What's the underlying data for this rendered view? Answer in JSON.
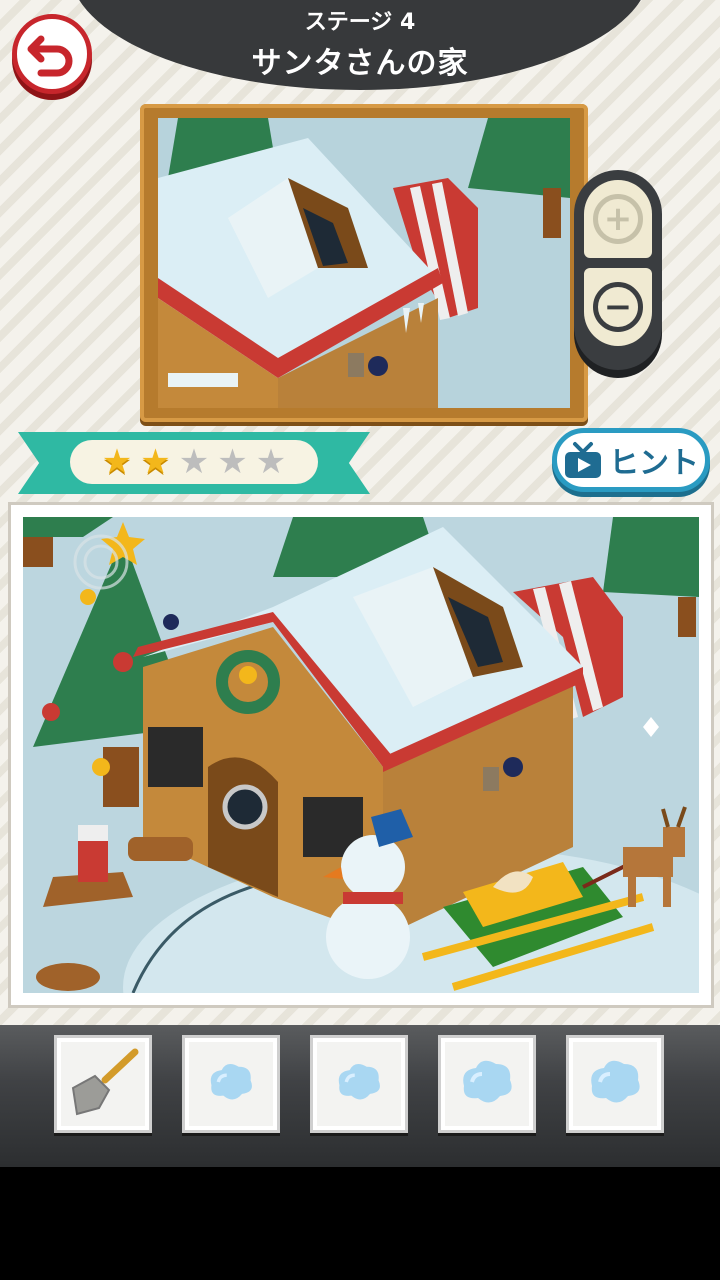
{
  "header": {
    "stage_label": "ステージ 4",
    "stage_title": "サンタさんの家"
  },
  "back_icon": "back-arrow-icon",
  "zoom": {
    "in_icon": "plus-icon",
    "out_icon": "minus-icon",
    "in_symbol": "+",
    "out_symbol": "−"
  },
  "stars": {
    "earned": 2,
    "total": 5
  },
  "hint": {
    "label": "ヒント",
    "icon": "tv-icon"
  },
  "inventory": [
    {
      "item": "shovel",
      "icon": "shovel-icon"
    },
    {
      "item": "snow-clump",
      "icon": "snow-clump-icon"
    },
    {
      "item": "snow-clump",
      "icon": "snow-clump-icon"
    },
    {
      "item": "snow-clump",
      "icon": "snow-clump-icon"
    },
    {
      "item": "snow-clump",
      "icon": "snow-clump-icon"
    }
  ],
  "colors": {
    "header": "#37393b",
    "accent_red": "#c7262c",
    "ribbon": "#2fb9a3",
    "hint_blue": "#2a9bc2",
    "star": "#f3b71b",
    "frame": "#b67b2d"
  }
}
